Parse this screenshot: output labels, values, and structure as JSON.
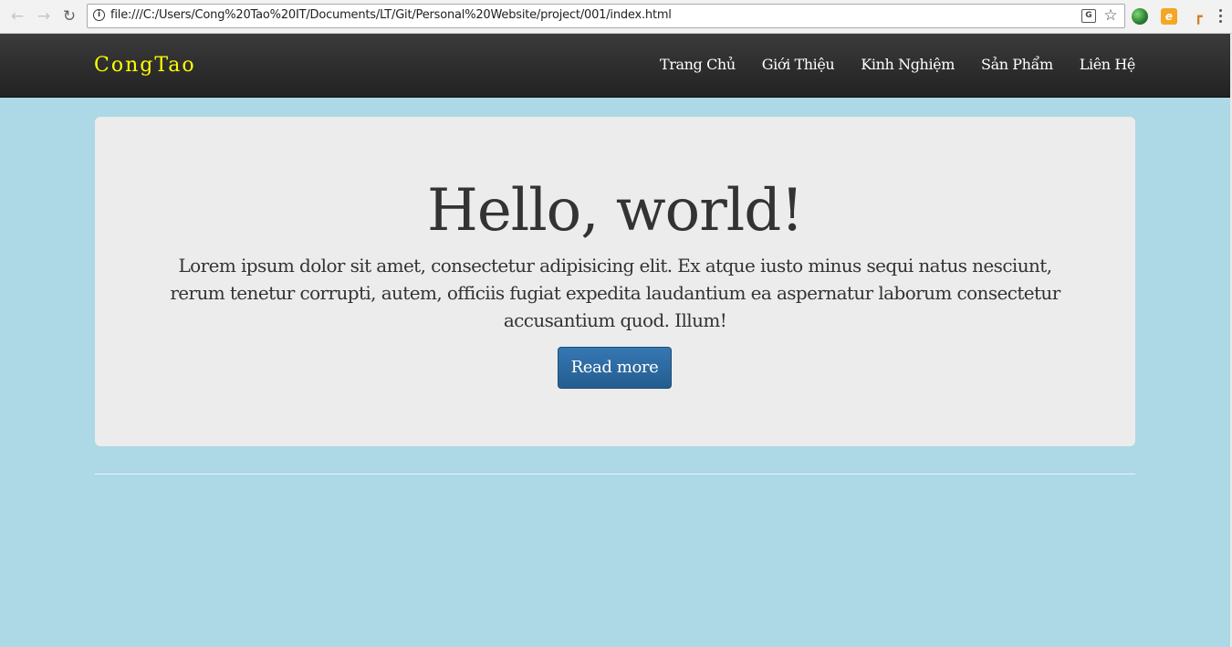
{
  "browser": {
    "url": "file:///C:/Users/Cong%20Tao%20IT/Documents/LT/Git/Personal%20Website/project/001/index.html",
    "back_icon": "←",
    "forward_icon": "→",
    "reload_icon": "↻",
    "info_icon": "i",
    "translate_icon": "G",
    "star_icon": "☆",
    "ext_e_label": "e",
    "ext_tool_label": "┏"
  },
  "navbar": {
    "brand": "CongTao",
    "brand_color": "#ffff00",
    "links": [
      {
        "label": "Trang Chủ"
      },
      {
        "label": "Giới Thiệu"
      },
      {
        "label": "Kinh Nghiệm"
      },
      {
        "label": "Sản Phẩm"
      },
      {
        "label": "Liên Hệ"
      }
    ]
  },
  "jumbotron": {
    "title": "Hello, world!",
    "text": "Lorem ipsum dolor sit amet, consectetur adipisicing elit. Ex atque iusto minus sequi natus nesciunt, rerum tenetur corrupti, autem, officiis fugiat expedita laudantium ea aspernatur laborum consectetur accusantium quod. Illum!",
    "button_label": "Read more"
  },
  "colors": {
    "page_background": "#add8e6",
    "jumbotron_background": "#ececec",
    "button_primary": "#2f6da3"
  }
}
